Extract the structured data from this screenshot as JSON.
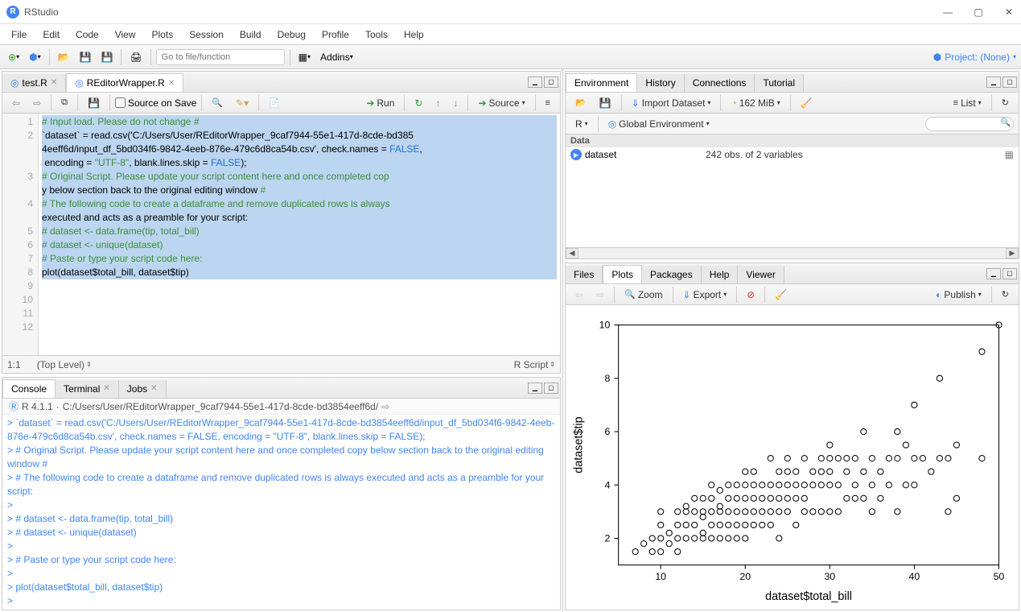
{
  "app": {
    "title": "RStudio",
    "project_label": "Project: (None)"
  },
  "menu": {
    "items": [
      "File",
      "Edit",
      "Code",
      "View",
      "Plots",
      "Session",
      "Build",
      "Debug",
      "Profile",
      "Tools",
      "Help"
    ]
  },
  "toolbar": {
    "goto_placeholder": "Go to file/function",
    "addins_label": "Addins"
  },
  "editor": {
    "tabs": [
      {
        "label": "test.R",
        "icon": "r-file-icon"
      },
      {
        "label": "REditorWrapper.R",
        "icon": "r-file-icon"
      }
    ],
    "source_on_save": "Source on Save",
    "run_label": "Run",
    "source_label": "Source",
    "status_pos": "1:1",
    "status_scope": "(Top Level)",
    "status_type": "R Script",
    "lines": [
      "# Input load. Please do not change #",
      "`dataset` = read.csv('C:/Users/User/REditorWrapper_9caf7944-55e1-417d-8cde-bd3854eeff6d/input_df_5bd034f6-9842-4eeb-876e-479c6d8ca54b.csv', check.names = FALSE, encoding = \"UTF-8\", blank.lines.skip = FALSE);",
      "# Original Script. Please update your script content here and once completed copy below section back to the original editing window #",
      "# The following code to create a dataframe and remove duplicated rows is always executed and acts as a preamble for your script:",
      "",
      "# dataset <- data.frame(tip, total_bill)",
      "# dataset <- unique(dataset)",
      "",
      "# Paste or type your script code here:",
      "",
      "plot(dataset$total_bill, dataset$tip)",
      ""
    ]
  },
  "console": {
    "tabs": [
      "Console",
      "Terminal",
      "Jobs"
    ],
    "r_version": "R 4.1.1",
    "path": "C:/Users/User/REditorWrapper_9caf7944-55e1-417d-8cde-bd3854eeff6d/",
    "lines": [
      "> `dataset` = read.csv('C:/Users/User/REditorWrapper_9caf7944-55e1-417d-8cde-bd3854eeff6d/input_df_5bd034f6-9842-4eeb-876e-479c6d8ca54b.csv', check.names = FALSE, encoding = \"UTF-8\", blank.lines.skip = FALSE);",
      "> # Original Script. Please update your script content here and once completed copy below section back to the original editing window #",
      "> # The following code to create a dataframe and remove duplicated rows is always executed and acts as a preamble for your script:",
      "> ",
      "> # dataset <- data.frame(tip, total_bill)",
      "> # dataset <- unique(dataset)",
      "> ",
      "> # Paste or type your script code here:",
      "> ",
      "> plot(dataset$total_bill, dataset$tip)",
      "> "
    ]
  },
  "environment": {
    "tabs": [
      "Environment",
      "History",
      "Connections",
      "Tutorial"
    ],
    "import_label": "Import Dataset",
    "mem_label": "162 MiB",
    "list_label": "List",
    "scope_r": "R",
    "scope_env": "Global Environment",
    "section": "Data",
    "rows": [
      {
        "name": "dataset",
        "value": "242 obs. of 2 variables"
      }
    ]
  },
  "plots": {
    "tabs": [
      "Files",
      "Plots",
      "Packages",
      "Help",
      "Viewer"
    ],
    "zoom": "Zoom",
    "export": "Export",
    "publish": "Publish"
  },
  "chart_data": {
    "type": "scatter",
    "title": "",
    "xlabel": "dataset$total_bill",
    "ylabel": "dataset$tip",
    "xlim": [
      5,
      50
    ],
    "ylim": [
      1,
      10
    ],
    "xticks": [
      10,
      20,
      30,
      40,
      50
    ],
    "yticks": [
      2,
      4,
      6,
      8,
      10
    ],
    "points": [
      [
        7,
        1.5
      ],
      [
        8,
        1.8
      ],
      [
        9,
        1.5
      ],
      [
        9,
        2
      ],
      [
        10,
        1.5
      ],
      [
        10,
        2
      ],
      [
        10,
        2.5
      ],
      [
        10,
        3
      ],
      [
        11,
        1.8
      ],
      [
        11,
        2.2
      ],
      [
        12,
        1.5
      ],
      [
        12,
        2
      ],
      [
        12,
        2.5
      ],
      [
        12,
        3
      ],
      [
        13,
        2
      ],
      [
        13,
        2.5
      ],
      [
        13,
        3
      ],
      [
        13,
        3.2
      ],
      [
        14,
        2
      ],
      [
        14,
        2.5
      ],
      [
        14,
        3
      ],
      [
        14,
        3.5
      ],
      [
        15,
        2
      ],
      [
        15,
        2.2
      ],
      [
        15,
        2.8
      ],
      [
        15,
        3
      ],
      [
        15,
        3.5
      ],
      [
        16,
        2
      ],
      [
        16,
        2.5
      ],
      [
        16,
        3
      ],
      [
        16,
        3.5
      ],
      [
        16,
        4
      ],
      [
        17,
        2
      ],
      [
        17,
        2.5
      ],
      [
        17,
        3
      ],
      [
        17,
        3.2
      ],
      [
        17,
        3.8
      ],
      [
        18,
        2
      ],
      [
        18,
        2.5
      ],
      [
        18,
        3
      ],
      [
        18,
        3.5
      ],
      [
        18,
        4
      ],
      [
        19,
        2
      ],
      [
        19,
        2.5
      ],
      [
        19,
        3
      ],
      [
        19,
        3.5
      ],
      [
        19,
        4
      ],
      [
        20,
        2
      ],
      [
        20,
        2.5
      ],
      [
        20,
        3
      ],
      [
        20,
        3.5
      ],
      [
        20,
        4
      ],
      [
        20,
        4.5
      ],
      [
        21,
        2.5
      ],
      [
        21,
        3
      ],
      [
        21,
        3.5
      ],
      [
        21,
        4
      ],
      [
        21,
        4.5
      ],
      [
        22,
        2.5
      ],
      [
        22,
        3
      ],
      [
        22,
        3.5
      ],
      [
        22,
        4
      ],
      [
        23,
        2.5
      ],
      [
        23,
        3
      ],
      [
        23,
        3.5
      ],
      [
        23,
        4
      ],
      [
        23,
        5
      ],
      [
        24,
        2
      ],
      [
        24,
        3
      ],
      [
        24,
        3.5
      ],
      [
        24,
        4
      ],
      [
        24,
        4.5
      ],
      [
        25,
        3
      ],
      [
        25,
        3.5
      ],
      [
        25,
        4
      ],
      [
        25,
        4.5
      ],
      [
        25,
        5
      ],
      [
        26,
        2.5
      ],
      [
        26,
        3.5
      ],
      [
        26,
        4
      ],
      [
        26,
        4.5
      ],
      [
        27,
        3
      ],
      [
        27,
        3.5
      ],
      [
        27,
        4
      ],
      [
        27,
        5
      ],
      [
        28,
        3
      ],
      [
        28,
        4
      ],
      [
        28,
        4.5
      ],
      [
        29,
        3
      ],
      [
        29,
        4
      ],
      [
        29,
        4.5
      ],
      [
        29,
        5
      ],
      [
        30,
        3
      ],
      [
        30,
        4
      ],
      [
        30,
        4.5
      ],
      [
        30,
        5
      ],
      [
        30,
        5.5
      ],
      [
        31,
        3
      ],
      [
        31,
        4
      ],
      [
        31,
        5
      ],
      [
        32,
        3.5
      ],
      [
        32,
        4.5
      ],
      [
        32,
        5
      ],
      [
        33,
        3.5
      ],
      [
        33,
        4
      ],
      [
        33,
        5
      ],
      [
        34,
        3.5
      ],
      [
        34,
        4.5
      ],
      [
        34,
        6
      ],
      [
        35,
        3
      ],
      [
        35,
        4
      ],
      [
        35,
        5
      ],
      [
        36,
        3.5
      ],
      [
        36,
        4.5
      ],
      [
        37,
        4
      ],
      [
        37,
        5
      ],
      [
        38,
        3
      ],
      [
        38,
        5
      ],
      [
        38,
        6
      ],
      [
        39,
        4
      ],
      [
        39,
        5.5
      ],
      [
        40,
        4
      ],
      [
        40,
        5
      ],
      [
        40,
        7
      ],
      [
        41,
        5
      ],
      [
        42,
        4.5
      ],
      [
        43,
        5
      ],
      [
        43,
        8
      ],
      [
        44,
        3
      ],
      [
        44,
        5
      ],
      [
        45,
        5.5
      ],
      [
        45,
        3.5
      ],
      [
        48,
        5
      ],
      [
        48,
        9
      ],
      [
        50,
        10
      ]
    ]
  }
}
